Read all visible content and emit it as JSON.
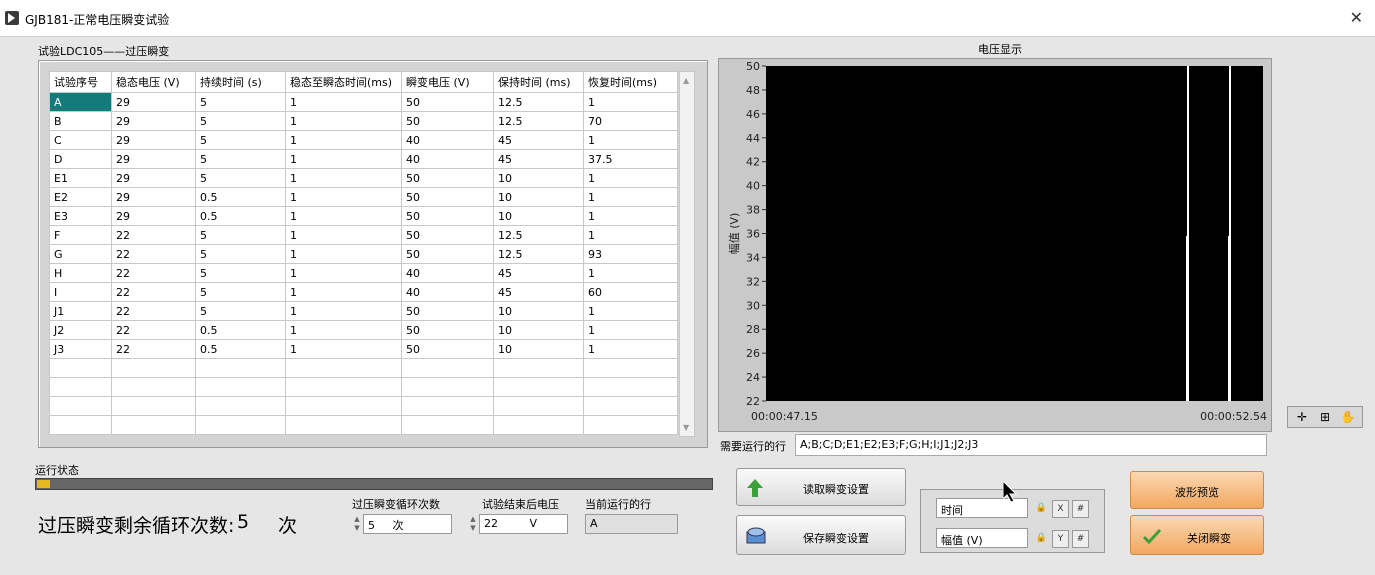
{
  "window": {
    "title": "GJB181-正常电压瞬变试验"
  },
  "section_title": "试验LDC105——过压瞬变",
  "table": {
    "headers": [
      "试验序号",
      "稳态电压 (V)",
      "持续时间 (s)",
      "稳态至瞬态时间(ms)",
      "瞬变电压 (V)",
      "保持时间 (ms)",
      "恢复时间(ms)"
    ],
    "rows": [
      [
        "A",
        "29",
        "5",
        "1",
        "50",
        "12.5",
        "1"
      ],
      [
        "B",
        "29",
        "5",
        "1",
        "50",
        "12.5",
        "70"
      ],
      [
        "C",
        "29",
        "5",
        "1",
        "40",
        "45",
        "1"
      ],
      [
        "D",
        "29",
        "5",
        "1",
        "40",
        "45",
        "37.5"
      ],
      [
        "E1",
        "29",
        "5",
        "1",
        "50",
        "10",
        "1"
      ],
      [
        "E2",
        "29",
        "0.5",
        "1",
        "50",
        "10",
        "1"
      ],
      [
        "E3",
        "29",
        "0.5",
        "1",
        "50",
        "10",
        "1"
      ],
      [
        "F",
        "22",
        "5",
        "1",
        "50",
        "12.5",
        "1"
      ],
      [
        "G",
        "22",
        "5",
        "1",
        "50",
        "12.5",
        "93"
      ],
      [
        "H",
        "22",
        "5",
        "1",
        "40",
        "45",
        "1"
      ],
      [
        "I",
        "22",
        "5",
        "1",
        "40",
        "45",
        "60"
      ],
      [
        "J1",
        "22",
        "5",
        "1",
        "50",
        "10",
        "1"
      ],
      [
        "J2",
        "22",
        "0.5",
        "1",
        "50",
        "10",
        "1"
      ],
      [
        "J3",
        "22",
        "0.5",
        "1",
        "50",
        "10",
        "1"
      ],
      [
        "",
        "",
        "",
        "",
        "",
        "",
        ""
      ],
      [
        "",
        "",
        "",
        "",
        "",
        "",
        ""
      ],
      [
        "",
        "",
        "",
        "",
        "",
        "",
        ""
      ],
      [
        "",
        "",
        "",
        "",
        "",
        "",
        ""
      ]
    ]
  },
  "status": {
    "label": "运行状态",
    "progress_fraction": 0.02
  },
  "remaining": {
    "label": "过压瞬变剩余循环次数:",
    "value": "5",
    "unit": "次"
  },
  "controls": {
    "cycle_label": "过压瞬变循环次数",
    "cycle_value": "5",
    "cycle_unit": "次",
    "end_voltage_label": "试验结束后电压",
    "end_voltage_value": "22",
    "end_voltage_unit": "V",
    "current_row_label": "当前运行的行",
    "current_row_value": "A"
  },
  "chart_title": "电压显示",
  "chart_data": {
    "type": "line",
    "title": "电压显示",
    "ylabel": "幅值 (V)",
    "xlabel": "",
    "ylim": [
      22,
      50
    ],
    "yticks": [
      "50",
      "48",
      "46",
      "44",
      "42",
      "40",
      "38",
      "36",
      "34",
      "32",
      "30",
      "28",
      "26",
      "24",
      "22"
    ],
    "xticks": [
      "00:00:47.15",
      "00:00:52.54"
    ],
    "background": "#000000",
    "trace_color": "#ffffff"
  },
  "rows_to_run": {
    "label": "需要运行的行",
    "value": "A;B;C;D;E1;E2;E3;F;G;H;I;J1;J2;J3"
  },
  "buttons": {
    "read_settings": "读取瞬变设置",
    "save_settings": "保存瞬变设置",
    "waveform_preview": "波形预览",
    "close_transient": "关闭瞬变"
  },
  "scale": {
    "time_label": "时间",
    "amplitude_label": "幅值 (V)"
  },
  "colors": {
    "selected_cell": "#157a7a",
    "progress": "#e6b820",
    "button_orange": "#f3a760"
  }
}
